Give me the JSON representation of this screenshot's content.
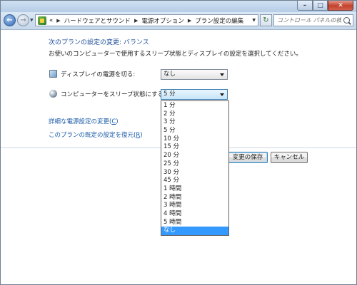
{
  "navigation": {
    "breadcrumbs": [
      "«",
      "ハードウェアとサウンド",
      "電源オプション",
      "プラン設定の編集"
    ],
    "search_placeholder": "コントロール パネルの検索"
  },
  "main": {
    "heading": "次のプランの設定の変更: バランス",
    "subtitle": "お使いのコンピューターで使用するスリープ状態とディスプレイの設定を選択してください。",
    "display_off": {
      "label": "ディスプレイの電源を切る:",
      "value": "なし",
      "icon": "monitor-icon"
    },
    "sleep": {
      "label": "コンピューターをスリープ状態にする:",
      "value": "5 分",
      "icon": "moon-icon"
    },
    "advanced_link": {
      "text": "詳細な電源設定の変更(",
      "key": "C",
      "end": ")"
    },
    "restore_link": {
      "text": "このプランの既定の設定を復元(",
      "key": "R",
      "end": ")"
    },
    "buttons": {
      "save": "変更の保存",
      "cancel": "キャンセル"
    }
  },
  "sleep_dropdown": {
    "options": [
      "1 分",
      "2 分",
      "3 分",
      "5 分",
      "10 分",
      "15 分",
      "20 分",
      "25 分",
      "30 分",
      "45 分",
      "1 時間",
      "2 時間",
      "3 時間",
      "4 時間",
      "5 時間",
      "なし"
    ],
    "highlighted": "なし"
  },
  "colors": {
    "link": "#1a5aa8",
    "heading": "#1f4e9a",
    "selection": "#3399ff"
  }
}
